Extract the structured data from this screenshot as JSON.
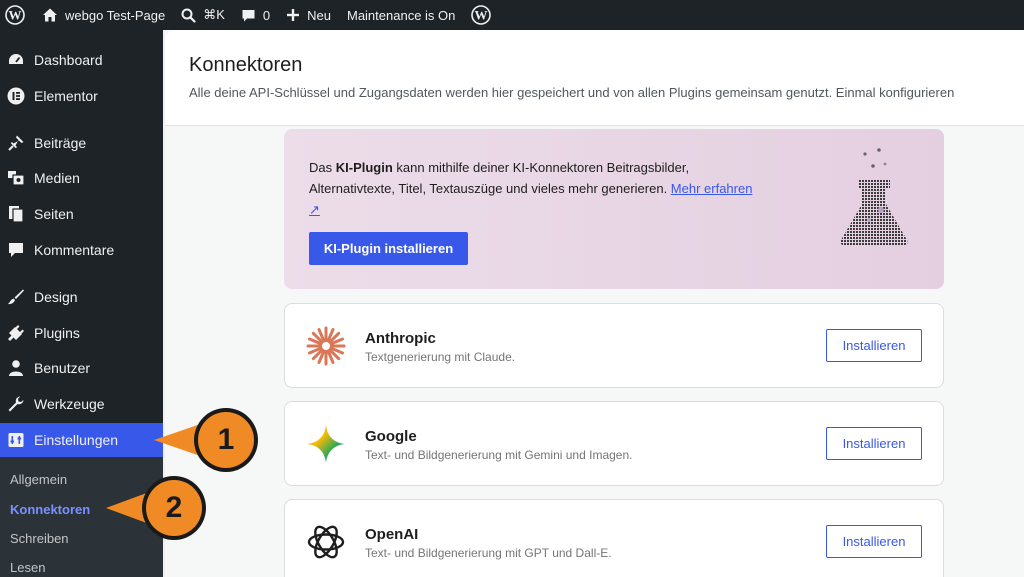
{
  "adminbar": {
    "site_name": "webgo Test-Page",
    "search_shortcut": "⌘K",
    "comments_count": "0",
    "new_label": "Neu",
    "maintenance": "Maintenance is On"
  },
  "sidebar": {
    "items": [
      {
        "label": "Dashboard",
        "icon": "dashboard-icon"
      },
      {
        "label": "Elementor",
        "icon": "elementor-icon"
      },
      {
        "label": "Beiträge",
        "icon": "pin-icon"
      },
      {
        "label": "Medien",
        "icon": "media-icon"
      },
      {
        "label": "Seiten",
        "icon": "pages-icon"
      },
      {
        "label": "Kommentare",
        "icon": "comment-icon"
      },
      {
        "label": "Design",
        "icon": "brush-icon"
      },
      {
        "label": "Plugins",
        "icon": "plugin-icon"
      },
      {
        "label": "Benutzer",
        "icon": "user-icon"
      },
      {
        "label": "Werkzeuge",
        "icon": "wrench-icon"
      },
      {
        "label": "Einstellungen",
        "icon": "settings-icon"
      }
    ],
    "submenu": [
      "Allgemein",
      "Konnektoren",
      "Schreiben",
      "Lesen"
    ]
  },
  "page": {
    "title": "Konnektoren",
    "description": "Alle deine API-Schlüssel und Zugangsdaten werden hier gespeichert und von allen Plugins gemeinsam genutzt. Einmal konfigurieren"
  },
  "promo": {
    "text_pre": "Das ",
    "text_bold": "KI-Plugin",
    "text_post": " kann mithilfe deiner KI-Konnektoren Beitragsbilder, Alternativtexte, Titel, Textauszüge und vieles mehr generieren. ",
    "link_label": "Mehr erfahren ↗",
    "button_label": "KI-Plugin installieren"
  },
  "connectors": [
    {
      "name": "Anthropic",
      "description": "Textgenerierung mit Claude.",
      "button": "Installieren"
    },
    {
      "name": "Google",
      "description": "Text- und Bildgenerierung mit Gemini und Imagen.",
      "button": "Installieren"
    },
    {
      "name": "OpenAI",
      "description": "Text- und Bildgenerierung mit GPT und Dall-E.",
      "button": "Installieren"
    }
  ],
  "callouts": [
    "1",
    "2"
  ],
  "colors": {
    "accent": "#3858e9",
    "callout": "#f08a24",
    "adminbar": "#1d2327"
  }
}
